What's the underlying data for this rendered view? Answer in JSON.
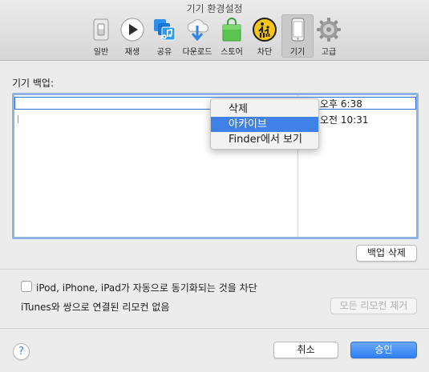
{
  "window": {
    "title": "기기 환경설정"
  },
  "toolbar": {
    "items": [
      {
        "label": "일반",
        "icon": "general-switch-icon"
      },
      {
        "label": "재생",
        "icon": "play-icon"
      },
      {
        "label": "공유",
        "icon": "music-share-icon"
      },
      {
        "label": "다운로드",
        "icon": "download-cloud-icon"
      },
      {
        "label": "스토어",
        "icon": "store-bag-icon"
      },
      {
        "label": "차단",
        "icon": "parental-control-icon"
      },
      {
        "label": "기기",
        "icon": "device-icon",
        "selected": true
      },
      {
        "label": "고급",
        "icon": "gear-icon"
      }
    ]
  },
  "backups": {
    "label": "기기 백업:",
    "rows": [
      {
        "name": "",
        "date": "오후 6:38",
        "selected": true
      },
      {
        "name": "",
        "date": "오전 10:31",
        "selected": false
      }
    ],
    "context_menu": {
      "items": [
        {
          "label": "삭제",
          "highlighted": false
        },
        {
          "label": "아카이브",
          "highlighted": true
        },
        {
          "label": "Finder에서 보기",
          "highlighted": false
        }
      ]
    },
    "delete_button": "백업 삭제"
  },
  "sync_prevent": {
    "label": "iPod, iPhone, iPad가 자동으로 동기화되는 것을 차단",
    "checked": false
  },
  "remotes": {
    "status": "iTunes와 쌍으로 연결된 리모컨 없음",
    "remove_button": "모든 리모컨 제거"
  },
  "footer": {
    "help": "?",
    "cancel": "취소",
    "ok": "승인"
  },
  "colors": {
    "accent": "#3f81e6",
    "focus_ring": "#8fb2e4",
    "window_bg": "#ececec"
  }
}
